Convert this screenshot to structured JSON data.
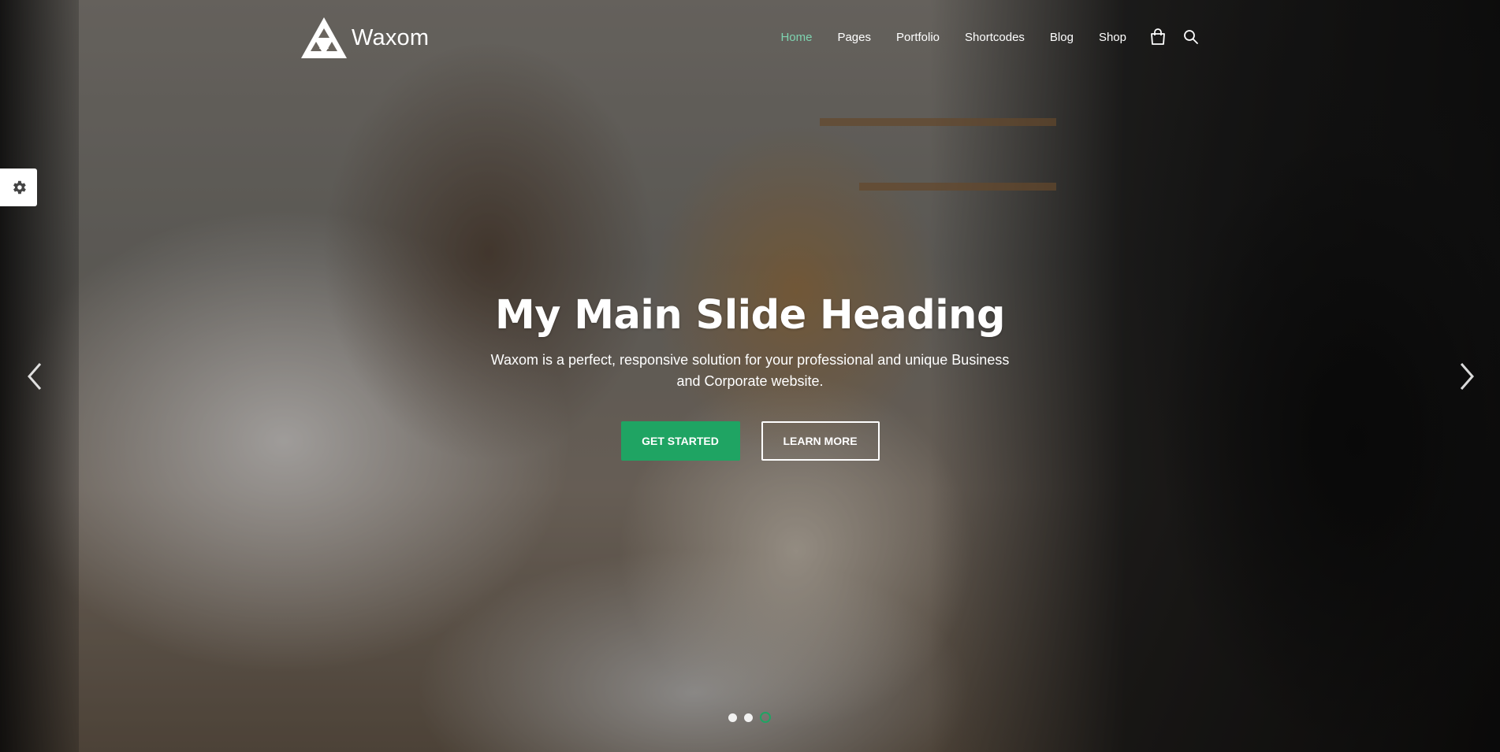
{
  "header": {
    "logo_text": "Waxom",
    "nav": [
      {
        "label": "Home",
        "active": true
      },
      {
        "label": "Pages",
        "active": false
      },
      {
        "label": "Portfolio",
        "active": false
      },
      {
        "label": "Shortcodes",
        "active": false
      },
      {
        "label": "Blog",
        "active": false
      },
      {
        "label": "Shop",
        "active": false
      }
    ],
    "icons": {
      "cart": "shopping-bag-icon",
      "search": "search-icon"
    }
  },
  "settings": {
    "icon": "gear-icon"
  },
  "slider": {
    "heading": "My Main Slide Heading",
    "subtext": "Waxom is a perfect, responsive solution for your professional and unique Business and Corporate website.",
    "primary_button": "GET STARTED",
    "secondary_button": "LEARN MORE",
    "prev_icon": "chevron-left-icon",
    "next_icon": "chevron-right-icon",
    "slide_count": 3,
    "active_slide": 3
  },
  "colors": {
    "accent": "#1fa463",
    "nav_active": "#7ed3b0",
    "text": "#ffffff"
  }
}
